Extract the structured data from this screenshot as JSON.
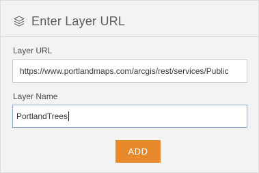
{
  "panel": {
    "title": "Enter Layer URL",
    "icon": "layers-icon"
  },
  "layer_url": {
    "label": "Layer URL",
    "value": "https://www.portlandmaps.com/arcgis/rest/services/Public"
  },
  "layer_name": {
    "label": "Layer Name",
    "value": "PortlandTrees"
  },
  "add_button": {
    "label": "ADD",
    "color": "#e8892c"
  }
}
